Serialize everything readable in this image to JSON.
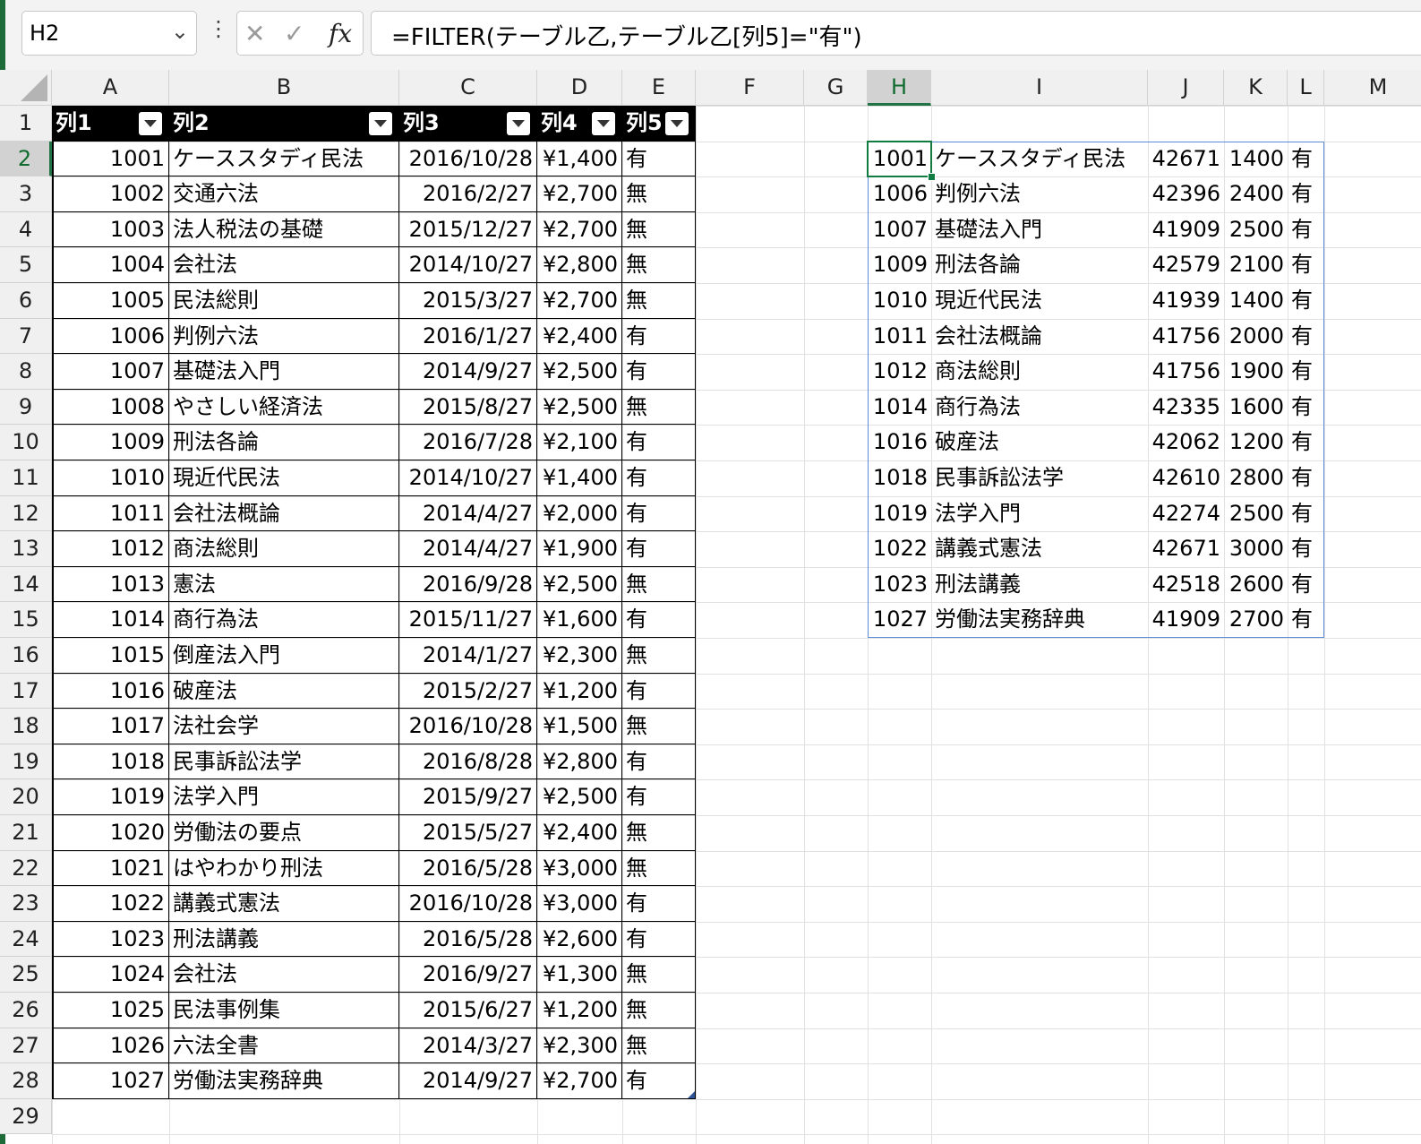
{
  "name_box": {
    "value": "H2"
  },
  "formula_bar": {
    "formula": "=FILTER(テーブル乙,テーブル乙[列5]=\"有\")"
  },
  "column_headers": [
    "A",
    "B",
    "C",
    "D",
    "E",
    "F",
    "G",
    "H",
    "I",
    "J",
    "K",
    "L",
    "M"
  ],
  "selected_column": "H",
  "selected_row": 2,
  "row_headers": [
    "1",
    "2",
    "3",
    "4",
    "5",
    "6",
    "7",
    "8",
    "9",
    "10",
    "11",
    "12",
    "13",
    "14",
    "15",
    "16",
    "17",
    "18",
    "19",
    "20",
    "21",
    "22",
    "23",
    "24",
    "25",
    "26",
    "27",
    "28",
    "29"
  ],
  "table": {
    "headers": [
      "列1",
      "列2",
      "列3",
      "列4",
      "列5"
    ],
    "rows": [
      [
        "1001",
        "ケーススタディ民法",
        "2016/10/28",
        "¥1,400",
        "有"
      ],
      [
        "1002",
        "交通六法",
        "2016/2/27",
        "¥2,700",
        "無"
      ],
      [
        "1003",
        "法人税法の基礎",
        "2015/12/27",
        "¥2,700",
        "無"
      ],
      [
        "1004",
        "会社法",
        "2014/10/27",
        "¥2,800",
        "無"
      ],
      [
        "1005",
        "民法総則",
        "2015/3/27",
        "¥2,700",
        "無"
      ],
      [
        "1006",
        "判例六法",
        "2016/1/27",
        "¥2,400",
        "有"
      ],
      [
        "1007",
        "基礎法入門",
        "2014/9/27",
        "¥2,500",
        "有"
      ],
      [
        "1008",
        "やさしい経済法",
        "2015/8/27",
        "¥2,500",
        "無"
      ],
      [
        "1009",
        "刑法各論",
        "2016/7/28",
        "¥2,100",
        "有"
      ],
      [
        "1010",
        "現近代民法",
        "2014/10/27",
        "¥1,400",
        "有"
      ],
      [
        "1011",
        "会社法概論",
        "2014/4/27",
        "¥2,000",
        "有"
      ],
      [
        "1012",
        "商法総則",
        "2014/4/27",
        "¥1,900",
        "有"
      ],
      [
        "1013",
        "憲法",
        "2016/9/28",
        "¥2,500",
        "無"
      ],
      [
        "1014",
        "商行為法",
        "2015/11/27",
        "¥1,600",
        "有"
      ],
      [
        "1015",
        "倒産法入門",
        "2014/1/27",
        "¥2,300",
        "無"
      ],
      [
        "1016",
        "破産法",
        "2015/2/27",
        "¥1,200",
        "有"
      ],
      [
        "1017",
        "法社会学",
        "2016/10/28",
        "¥1,500",
        "無"
      ],
      [
        "1018",
        "民事訴訟法学",
        "2016/8/28",
        "¥2,800",
        "有"
      ],
      [
        "1019",
        "法学入門",
        "2015/9/27",
        "¥2,500",
        "有"
      ],
      [
        "1020",
        "労働法の要点",
        "2015/5/27",
        "¥2,400",
        "無"
      ],
      [
        "1021",
        "はやわかり刑法",
        "2016/5/28",
        "¥3,000",
        "無"
      ],
      [
        "1022",
        "講義式憲法",
        "2016/10/28",
        "¥3,000",
        "有"
      ],
      [
        "1023",
        "刑法講義",
        "2016/5/28",
        "¥2,600",
        "有"
      ],
      [
        "1024",
        "会社法",
        "2016/9/27",
        "¥1,300",
        "無"
      ],
      [
        "1025",
        "民法事例集",
        "2015/6/27",
        "¥1,200",
        "無"
      ],
      [
        "1026",
        "六法全書",
        "2014/3/27",
        "¥2,300",
        "無"
      ],
      [
        "1027",
        "労働法実務辞典",
        "2014/9/27",
        "¥2,700",
        "有"
      ]
    ]
  },
  "spill": {
    "rows": [
      [
        "1001",
        "ケーススタディ民法",
        "42671",
        "1400",
        "有"
      ],
      [
        "1006",
        "判例六法",
        "42396",
        "2400",
        "有"
      ],
      [
        "1007",
        "基礎法入門",
        "41909",
        "2500",
        "有"
      ],
      [
        "1009",
        "刑法各論",
        "42579",
        "2100",
        "有"
      ],
      [
        "1010",
        "現近代民法",
        "41939",
        "1400",
        "有"
      ],
      [
        "1011",
        "会社法概論",
        "41756",
        "2000",
        "有"
      ],
      [
        "1012",
        "商法総則",
        "41756",
        "1900",
        "有"
      ],
      [
        "1014",
        "商行為法",
        "42335",
        "1600",
        "有"
      ],
      [
        "1016",
        "破産法",
        "42062",
        "1200",
        "有"
      ],
      [
        "1018",
        "民事訴訟法学",
        "42610",
        "2800",
        "有"
      ],
      [
        "1019",
        "法学入門",
        "42274",
        "2500",
        "有"
      ],
      [
        "1022",
        "講義式憲法",
        "42671",
        "3000",
        "有"
      ],
      [
        "1023",
        "刑法講義",
        "42518",
        "2600",
        "有"
      ],
      [
        "1027",
        "労働法実務辞典",
        "41909",
        "2700",
        "有"
      ]
    ]
  },
  "icons": {
    "name_box_dropdown": "chevron-down-icon",
    "more": "more-vertical-icon",
    "cancel": "cancel-x-icon",
    "enter": "checkmark-icon",
    "insert_function": "fx-icon"
  },
  "colors": {
    "table_header_bg": "#000000",
    "active_cell": "#107c41",
    "spill_border": "#5b8dd6"
  }
}
